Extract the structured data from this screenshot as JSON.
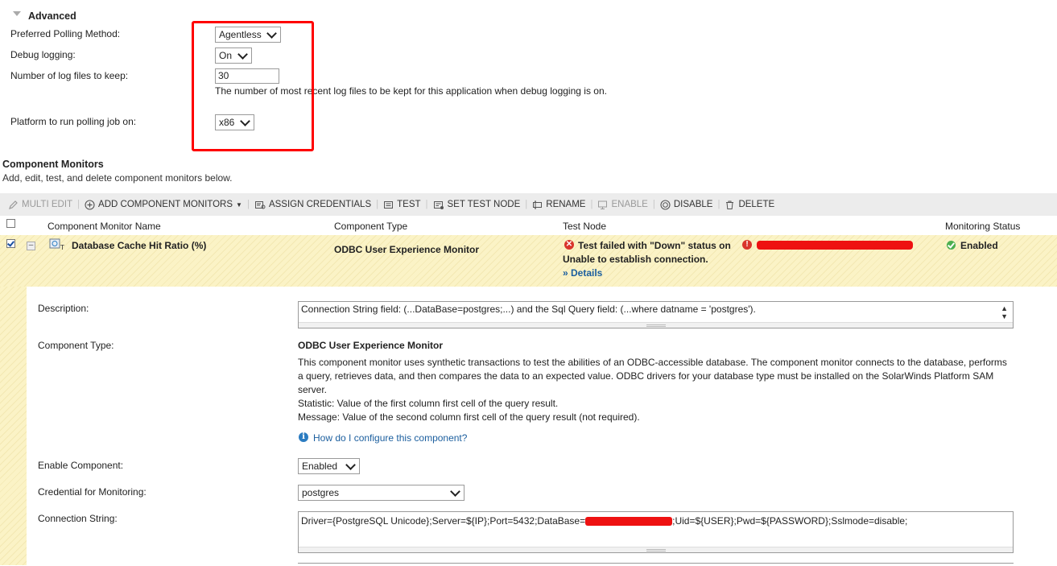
{
  "advanced": {
    "section_title": "Advanced",
    "preferred_polling_label": "Preferred Polling Method:",
    "preferred_polling_value": "Agentless",
    "debug_logging_label": "Debug logging:",
    "debug_logging_value": "On",
    "log_files_label": "Number of log files to keep:",
    "log_files_value": "30",
    "log_files_help": "The number of most recent log files to be kept for this application when debug logging is on.",
    "platform_label": "Platform to run polling job on:",
    "platform_value": "x86"
  },
  "component_monitors": {
    "title": "Component Monitors",
    "subtitle": "Add, edit, test, and delete component monitors below."
  },
  "toolbar": {
    "multi_edit": "MULTI EDIT",
    "add_component_monitors": "ADD COMPONENT MONITORS",
    "assign_credentials": "ASSIGN CREDENTIALS",
    "test": "TEST",
    "set_test_node": "SET TEST NODE",
    "rename": "RENAME",
    "enable": "ENABLE",
    "disable": "DISABLE",
    "delete": "DELETE"
  },
  "table": {
    "columns": [
      "Component Monitor Name",
      "Component Type",
      "Test Node",
      "Monitoring Status"
    ],
    "row": {
      "name": "Database Cache Hit Ratio (%)",
      "type": "ODBC User Experience Monitor",
      "test_result": "Test failed with \"Down\" status on",
      "test_message": "Unable to establish connection.",
      "details_link": "» Details",
      "status": "Enabled"
    }
  },
  "detail": {
    "description_label": "Description:",
    "description_value": "Connection String field:  (...DataBase=postgres;...) and the Sql Query field: (...where datname = 'postgres').",
    "component_type_label": "Component Type:",
    "component_type_title": "ODBC User Experience Monitor",
    "component_type_desc": "This component monitor uses synthetic transactions to test the abilities of an ODBC-accessible database. The component monitor connects to the database, performs a query, retrieves data, and then compares the data to an expected value. ODBC drivers for your database type must be installed on the SolarWinds Platform SAM server.",
    "statistic_line": "Statistic: Value of the first column first cell of the query result.",
    "message_line": "Message: Value of the second column first cell of the query result (not required).",
    "help_link": "How do I configure this component?",
    "enable_label": "Enable Component:",
    "enable_value": "Enabled",
    "credential_label": "Credential for Monitoring:",
    "credential_value": "postgres",
    "connection_label": "Connection String:",
    "connection_prefix": "Driver={PostgreSQL Unicode};Server=${IP};Port=5432;DataBase=",
    "connection_suffix": ";Uid=${USER};Pwd=${PASSWORD};Sslmode=disable;"
  }
}
